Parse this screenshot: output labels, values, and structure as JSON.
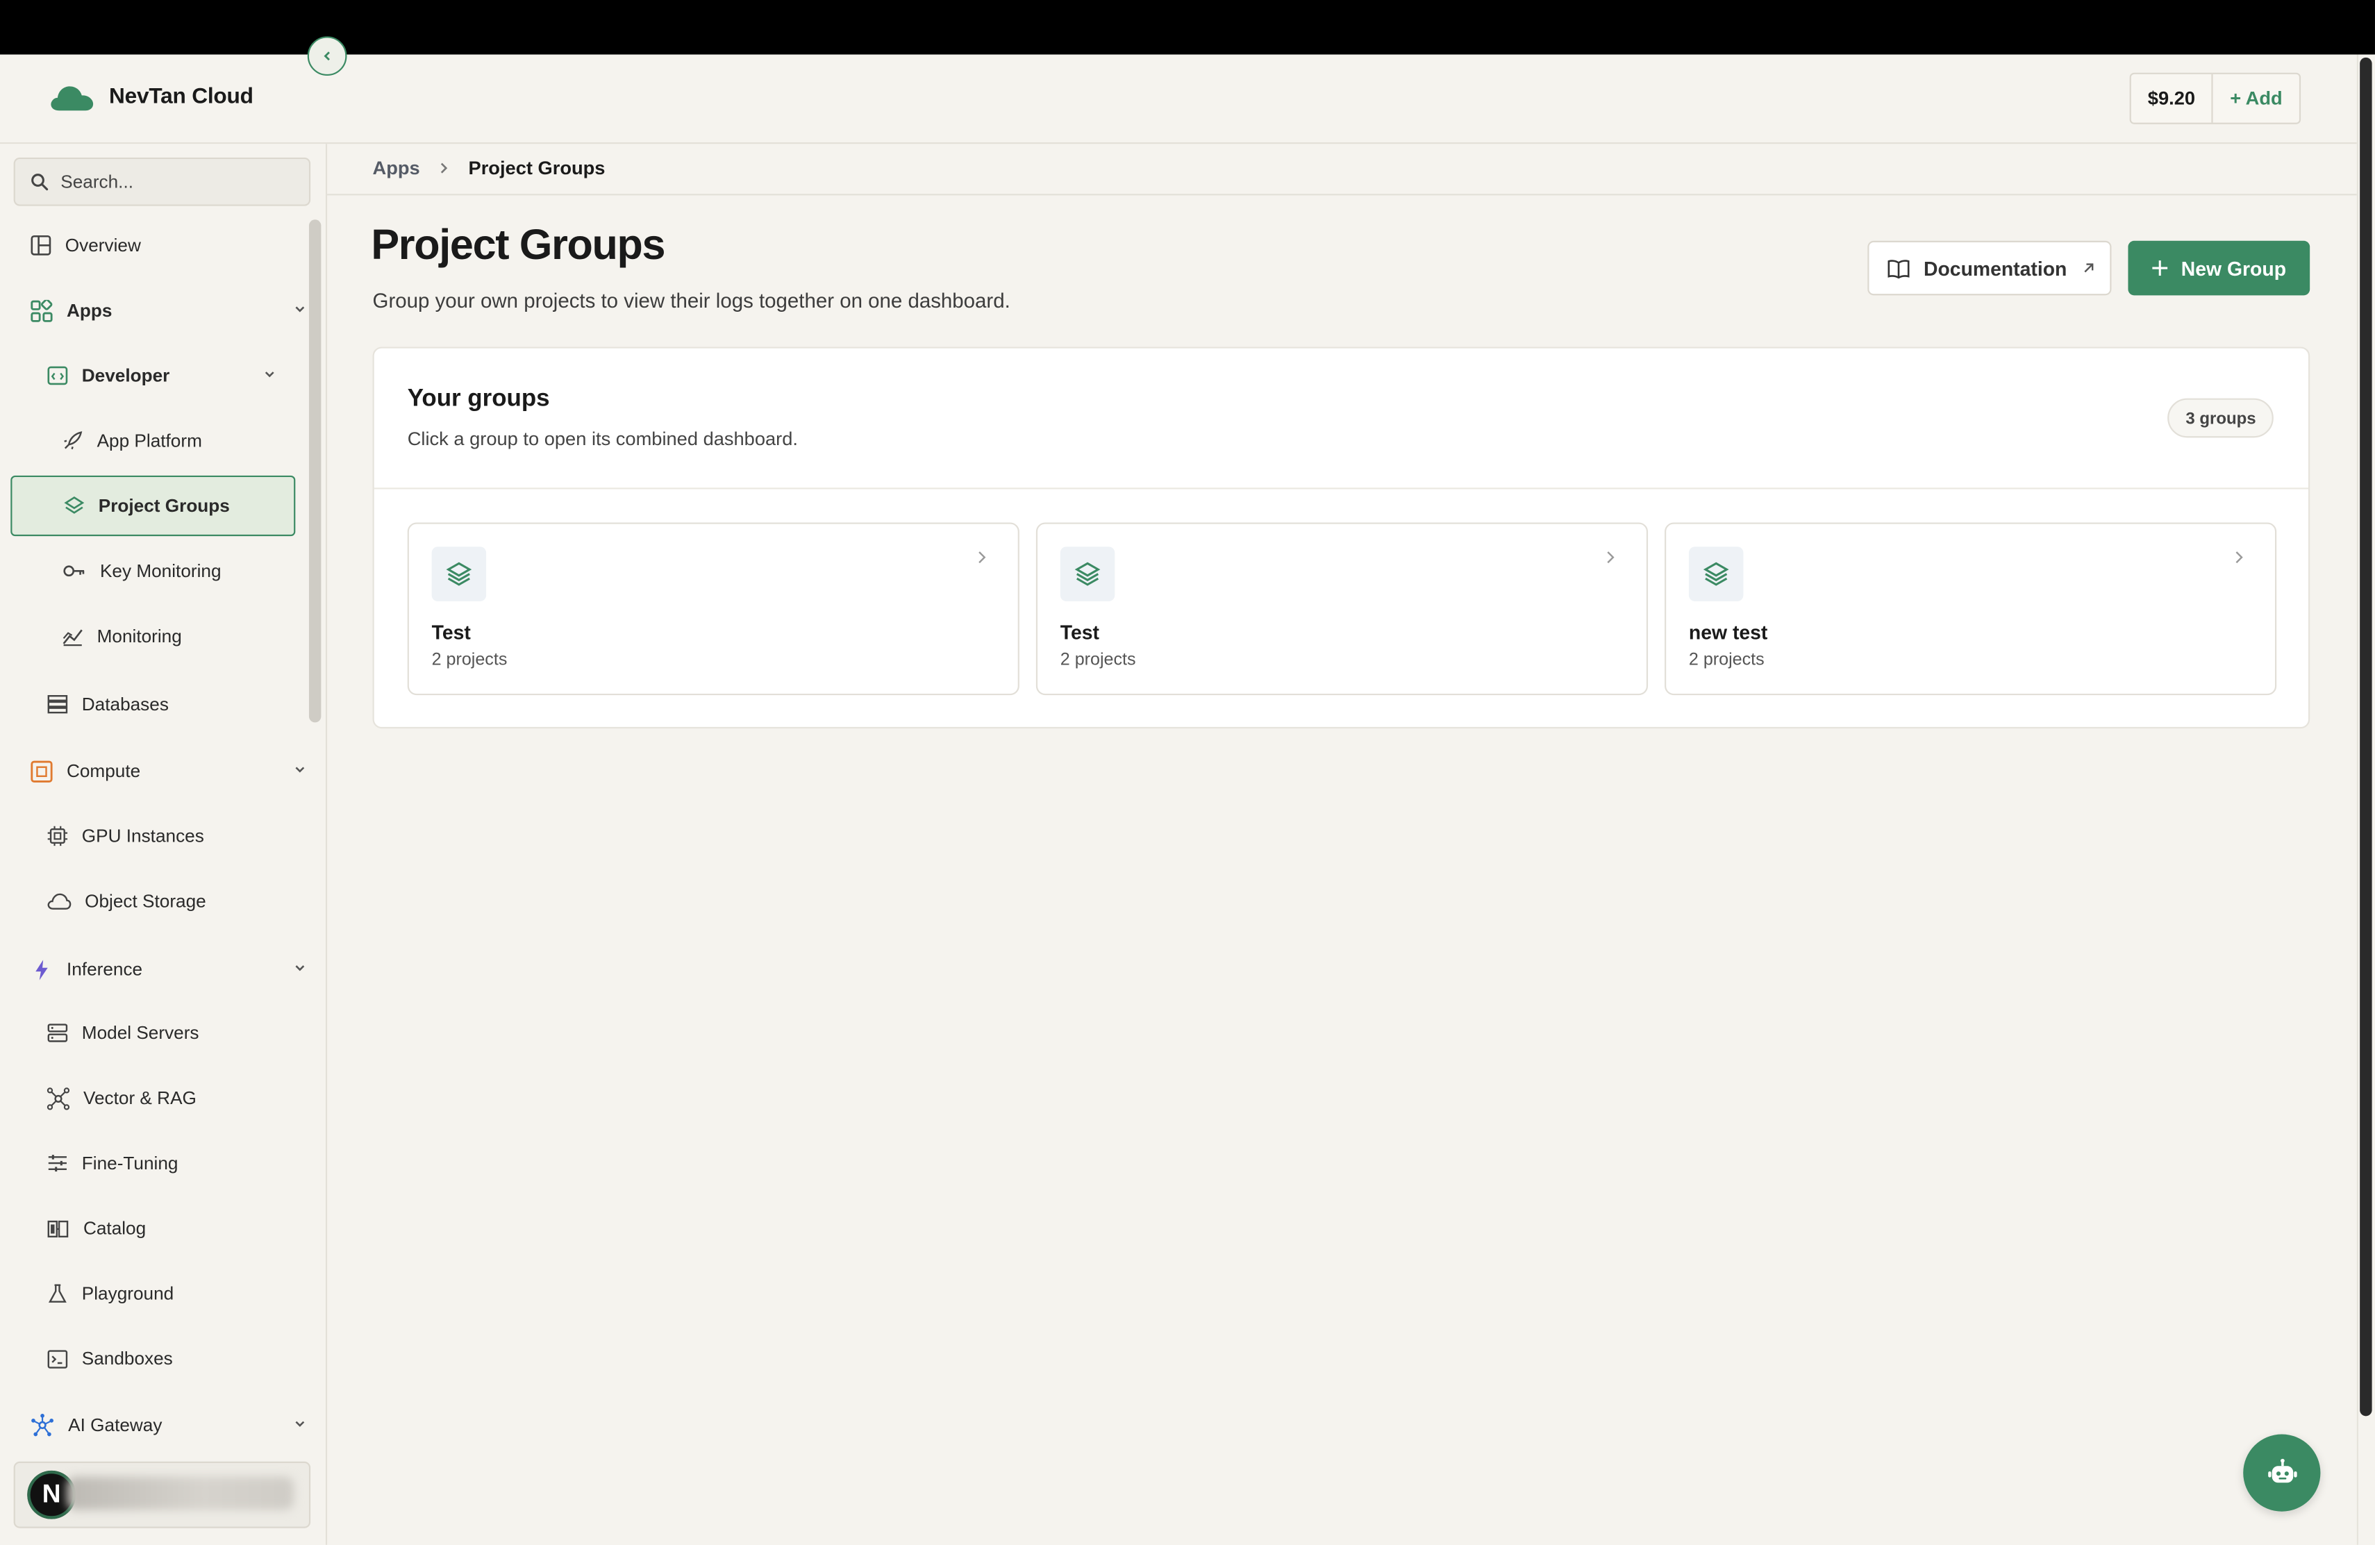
{
  "header": {
    "brand_name": "NevTan Cloud",
    "credit_amount": "$9.20",
    "add_label": "+ Add"
  },
  "sidebar": {
    "search_placeholder": "Search...",
    "items": [
      {
        "label": "Overview",
        "icon": "layout-icon"
      },
      {
        "label": "Apps",
        "icon": "apps-grid-icon"
      },
      {
        "label": "Developer",
        "icon": "code-window-icon"
      },
      {
        "label": "App Platform",
        "icon": "rocket-icon"
      },
      {
        "label": "Project Groups",
        "icon": "layers-icon"
      },
      {
        "label": "Key Monitoring",
        "icon": "key-icon"
      },
      {
        "label": "Monitoring",
        "icon": "chart-line-icon"
      },
      {
        "label": "Databases",
        "icon": "database-icon"
      },
      {
        "label": "Compute",
        "icon": "cpu-icon"
      },
      {
        "label": "GPU Instances",
        "icon": "chip-icon"
      },
      {
        "label": "Object Storage",
        "icon": "cloud-icon"
      },
      {
        "label": "Inference",
        "icon": "bolt-icon"
      },
      {
        "label": "Model Servers",
        "icon": "server-icon"
      },
      {
        "label": "Vector & RAG",
        "icon": "network-icon"
      },
      {
        "label": "Fine-Tuning",
        "icon": "sliders-icon"
      },
      {
        "label": "Catalog",
        "icon": "book-icon"
      },
      {
        "label": "Playground",
        "icon": "flask-icon"
      },
      {
        "label": "Sandboxes",
        "icon": "terminal-icon"
      },
      {
        "label": "AI Gateway",
        "icon": "gateway-icon"
      }
    ],
    "user_initial": "N"
  },
  "breadcrumb": {
    "parent": "Apps",
    "current": "Project Groups"
  },
  "page": {
    "title": "Project Groups",
    "subtitle": "Group your own projects to view their logs together on one dashboard.",
    "doc_button": "Documentation",
    "new_button": "New Group"
  },
  "groups_panel": {
    "title": "Your groups",
    "subtitle": "Click a group to open its combined dashboard.",
    "count_badge": "3 groups",
    "groups": [
      {
        "name": "Test",
        "count": "2 projects"
      },
      {
        "name": "Test",
        "count": "2 projects"
      },
      {
        "name": "new test",
        "count": "2 projects"
      }
    ]
  },
  "colors": {
    "accent": "#3b8a63",
    "background": "#f5f3ee",
    "active_bg": "#e3ecdf"
  }
}
